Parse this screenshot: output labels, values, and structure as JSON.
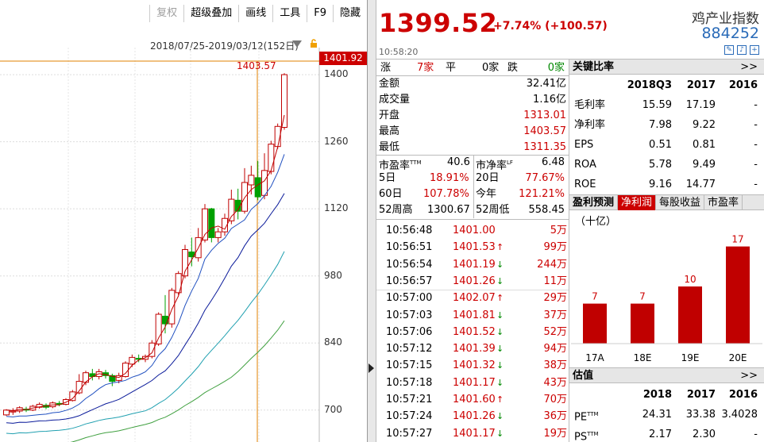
{
  "toolbar": {
    "items": [
      "复权",
      "超级叠加",
      "画线",
      "工具",
      "F9",
      "隐藏"
    ]
  },
  "chart": {
    "date_range": "2018/07/25-2019/03/12(152日)",
    "scale_value": "1401.92",
    "high_label": "1403.57",
    "y_ticks": [
      "1400",
      "1260",
      "1120",
      "980",
      "840",
      "700"
    ],
    "colors": {
      "up": "#c00000",
      "down": "#00a000",
      "ma1": "#c00000",
      "ma2": "#2050c0",
      "ma3": "#0a1a9a",
      "ma4": "#20a0b0",
      "ma5": "#40a040",
      "crosshair": "#e08000"
    }
  },
  "chart_data": {
    "type": "candlestick",
    "ylim": [
      650,
      1420
    ],
    "candles": [
      [
        690,
        700,
        688,
        702
      ],
      [
        696,
        698,
        690,
        704
      ],
      [
        698,
        705,
        694,
        708
      ],
      [
        702,
        700,
        696,
        707
      ],
      [
        700,
        708,
        698,
        711
      ],
      [
        706,
        712,
        703,
        716
      ],
      [
        710,
        706,
        702,
        714
      ],
      [
        707,
        715,
        704,
        718
      ],
      [
        714,
        712,
        708,
        719
      ],
      [
        712,
        722,
        710,
        725
      ],
      [
        720,
        738,
        718,
        742
      ],
      [
        736,
        760,
        733,
        775
      ],
      [
        758,
        778,
        752,
        782
      ],
      [
        776,
        770,
        762,
        786
      ],
      [
        770,
        780,
        764,
        786
      ],
      [
        778,
        772,
        766,
        784
      ],
      [
        772,
        760,
        750,
        776
      ],
      [
        762,
        772,
        756,
        778
      ],
      [
        770,
        798,
        768,
        802
      ],
      [
        796,
        810,
        790,
        816
      ],
      [
        808,
        806,
        800,
        816
      ],
      [
        806,
        812,
        800,
        816
      ],
      [
        812,
        840,
        808,
        846
      ],
      [
        838,
        900,
        834,
        904
      ],
      [
        896,
        880,
        860,
        940
      ],
      [
        880,
        950,
        872,
        955
      ],
      [
        945,
        985,
        940,
        990
      ],
      [
        980,
        1035,
        975,
        1045
      ],
      [
        1030,
        1020,
        1000,
        1060
      ],
      [
        1018,
        1060,
        1010,
        1080
      ],
      [
        1055,
        1120,
        1050,
        1130
      ],
      [
        1120,
        1060,
        1050,
        1122
      ],
      [
        1060,
        1072,
        1050,
        1080
      ],
      [
        1072,
        1100,
        1064,
        1110
      ],
      [
        1095,
        1140,
        1088,
        1160
      ],
      [
        1138,
        1115,
        1098,
        1162
      ],
      [
        1115,
        1175,
        1110,
        1205
      ],
      [
        1170,
        1190,
        1150,
        1210
      ],
      [
        1185,
        1145,
        1138,
        1220
      ],
      [
        1148,
        1200,
        1140,
        1236
      ],
      [
        1198,
        1255,
        1192,
        1262
      ],
      [
        1250,
        1292,
        1245,
        1298
      ],
      [
        1290,
        1400,
        1285,
        1403
      ]
    ],
    "xlabel": "",
    "ylabel": ""
  },
  "quote": {
    "price": "1399.52",
    "change": "+7.74% (+100.57)",
    "time": "10:58:20",
    "name": "鸡产业指数",
    "code": "884252",
    "rise_label": "涨",
    "rise_val": "7家",
    "flat_label": "平",
    "flat_val": "0家",
    "fall_label": "跌",
    "fall_val": "0家",
    "rows": [
      {
        "label": "金额",
        "value": "32.41亿",
        "color": "black"
      },
      {
        "label": "成交量",
        "value": "1.16亿",
        "color": "black"
      },
      {
        "label": "开盘",
        "value": "1313.01",
        "color": "red"
      },
      {
        "label": "最高",
        "value": "1403.57",
        "color": "red"
      },
      {
        "label": "最低",
        "value": "1311.35",
        "color": "red"
      }
    ],
    "pe_label": "市盈率",
    "pe_sup": "TTM",
    "pe_val": "40.6",
    "pb_label": "市净率",
    "pb_sup": "LF",
    "pb_val": "6.48",
    "d5_label": "5日",
    "d5_val": "18.91%",
    "d20_label": "20日",
    "d20_val": "77.67%",
    "d60_label": "60日",
    "d60_val": "107.78%",
    "ytd_label": "今年",
    "ytd_val": "121.21%",
    "w52h_label": "52周高",
    "w52h_val": "1300.67",
    "w52l_label": "52周低",
    "w52l_val": "558.45"
  },
  "ticks": [
    {
      "time": "10:56:48",
      "price": "1401.00",
      "dir": "",
      "vol": "5万"
    },
    {
      "time": "10:56:51",
      "price": "1401.53",
      "dir": "up",
      "vol": "99万"
    },
    {
      "time": "10:56:54",
      "price": "1401.19",
      "dir": "down",
      "vol": "244万"
    },
    {
      "time": "10:56:57",
      "price": "1401.26",
      "dir": "down",
      "vol": "11万"
    },
    {
      "time": "10:57:00",
      "price": "1402.07",
      "dir": "up",
      "vol": "29万"
    },
    {
      "time": "10:57:03",
      "price": "1401.81",
      "dir": "down",
      "vol": "37万"
    },
    {
      "time": "10:57:06",
      "price": "1401.52",
      "dir": "down",
      "vol": "52万"
    },
    {
      "time": "10:57:12",
      "price": "1401.39",
      "dir": "down",
      "vol": "94万"
    },
    {
      "time": "10:57:15",
      "price": "1401.32",
      "dir": "down",
      "vol": "38万"
    },
    {
      "time": "10:57:18",
      "price": "1401.17",
      "dir": "down",
      "vol": "43万"
    },
    {
      "time": "10:57:21",
      "price": "1401.60",
      "dir": "up",
      "vol": "70万"
    },
    {
      "time": "10:57:24",
      "price": "1401.26",
      "dir": "down",
      "vol": "36万"
    },
    {
      "time": "10:57:27",
      "price": "1401.17",
      "dir": "down",
      "vol": "19万"
    }
  ],
  "ratios": {
    "title": "关键比率",
    "more": ">>",
    "headers": [
      "",
      "2018Q3",
      "2017",
      "2016"
    ],
    "rows": [
      [
        "毛利率",
        "15.59",
        "17.19",
        "-"
      ],
      [
        "净利率",
        "7.98",
        "9.22",
        "-"
      ],
      [
        "EPS",
        "0.51",
        "0.81",
        "-"
      ],
      [
        "ROA",
        "5.78",
        "9.49",
        "-"
      ],
      [
        "ROE",
        "9.16",
        "14.77",
        "-"
      ]
    ]
  },
  "forecast": {
    "tabs": [
      "盈利预测",
      "净利润",
      "每股收益",
      "市盈率"
    ],
    "active": 1,
    "unit": "（十亿）",
    "categories": [
      "17A",
      "18E",
      "19E",
      "20E"
    ],
    "values": [
      7,
      7,
      10,
      17
    ],
    "bar_color": "#c00000"
  },
  "valuation": {
    "title": "估值",
    "more": ">>",
    "headers": [
      "",
      "2018",
      "2017",
      "2016"
    ],
    "rows": [
      [
        "PE",
        "TTM",
        "24.31",
        "33.38",
        "3.4028"
      ],
      [
        "PS",
        "TTM",
        "2.17",
        "2.30",
        "-"
      ]
    ]
  }
}
